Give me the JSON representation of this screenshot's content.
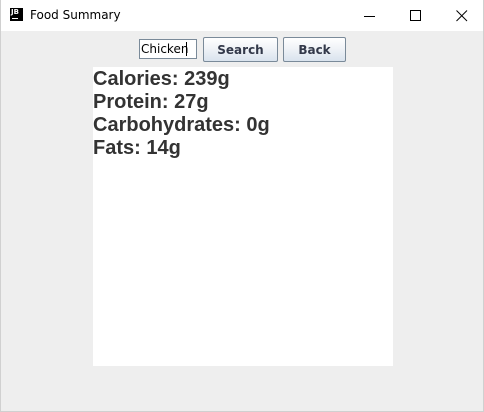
{
  "window": {
    "title": "Food Summary",
    "app_icon_text": "JB",
    "icon_name": "java-app-icon"
  },
  "controls": {
    "minimize_icon": "minimize-icon",
    "maximize_icon": "maximize-icon",
    "close_icon": "close-icon"
  },
  "search": {
    "value": "Chicken",
    "button_label": "Search"
  },
  "back": {
    "button_label": "Back"
  },
  "results": {
    "lines": [
      "Calories: 239g",
      "Protein: 27g",
      "Carbohydrates: 0g",
      "Fats: 14g"
    ]
  }
}
